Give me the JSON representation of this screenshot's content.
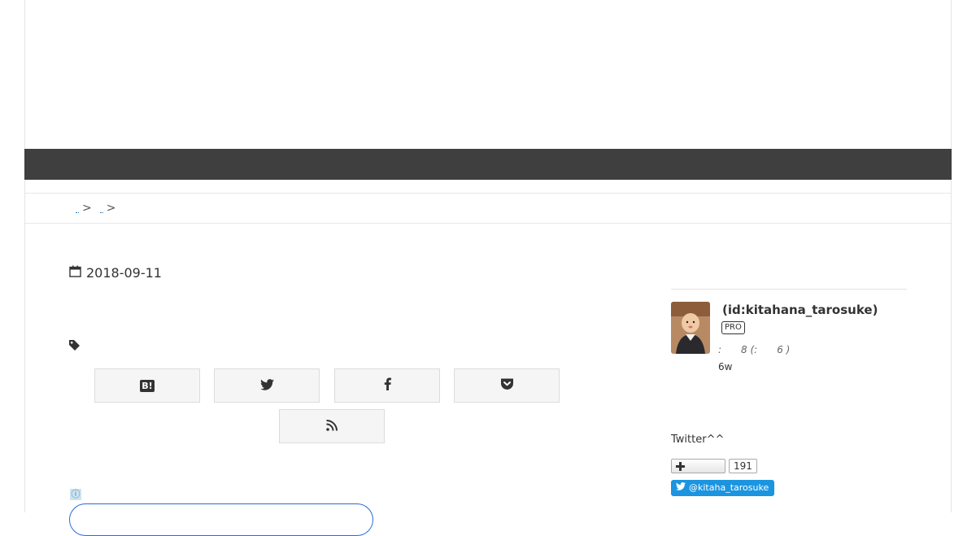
{
  "breadcrumb": {
    "separator_1": ">",
    "separator_2": ">"
  },
  "entry": {
    "date": "2018-09-11"
  },
  "share": {
    "buttons": [
      {
        "icon": "hatena-bookmark-icon",
        "label": "B!"
      },
      {
        "icon": "twitter-icon"
      },
      {
        "icon": "facebook-icon"
      },
      {
        "icon": "pocket-icon"
      },
      {
        "icon": "rss-icon"
      }
    ]
  },
  "ad": {
    "info_icon": "ⓘ"
  },
  "profile": {
    "name": "(id:kitahana_tarosuke)",
    "badge": "PRO",
    "stats": ":　　8 (:　　6 )",
    "extra": "6w"
  },
  "twitter_widget": {
    "heading": "Twitter^^",
    "follower_count": "191",
    "follow_label": "@kitaha_tarosuke"
  },
  "colors": {
    "navbar": "#3f3f3f",
    "twitter_blue": "#1b95e0"
  }
}
